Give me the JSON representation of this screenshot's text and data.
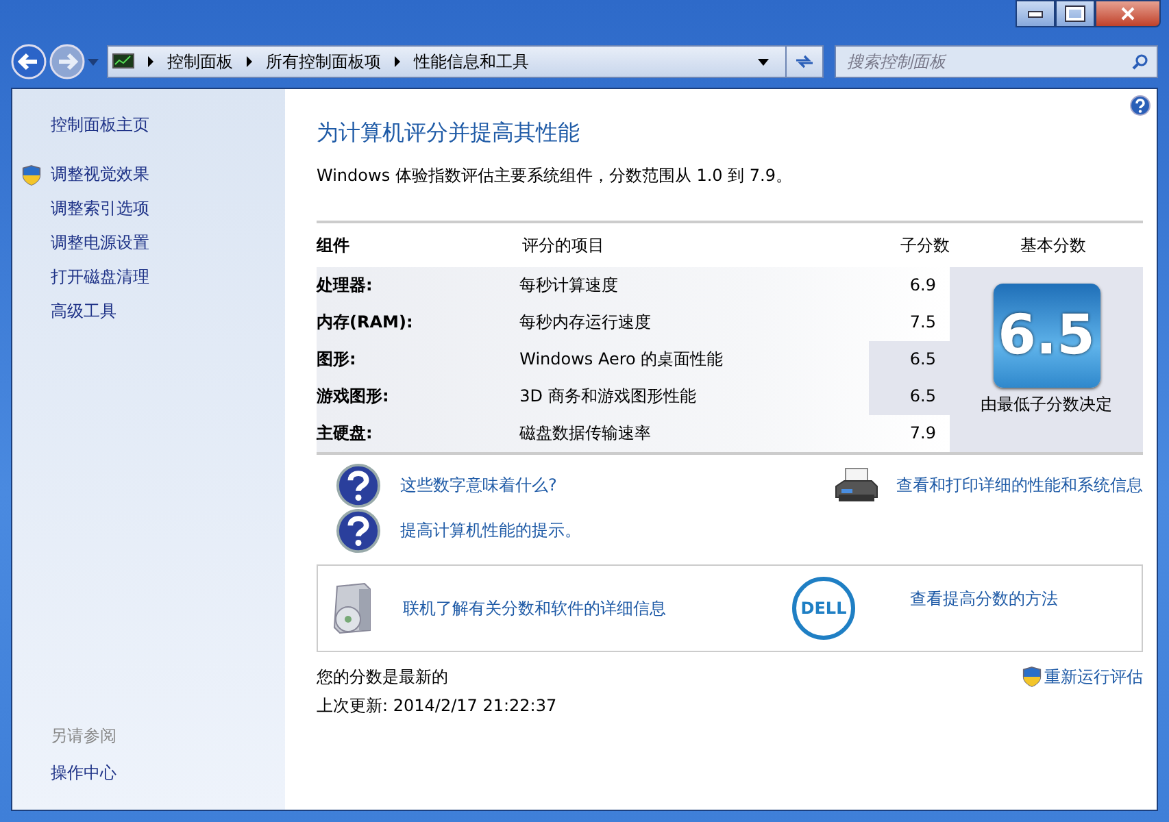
{
  "address_bar": {
    "crumbs": [
      "控制面板",
      "所有控制面板项",
      "性能信息和工具"
    ]
  },
  "search": {
    "placeholder": "搜索控制面板"
  },
  "sidebar": {
    "items": [
      {
        "label": "控制面板主页",
        "shield": false
      },
      {
        "label": "调整视觉效果",
        "shield": true
      },
      {
        "label": "调整索引选项",
        "shield": false
      },
      {
        "label": "调整电源设置",
        "shield": false
      },
      {
        "label": "打开磁盘清理",
        "shield": false
      },
      {
        "label": "高级工具",
        "shield": false
      }
    ],
    "see_also": {
      "heading": "另请参阅",
      "items": [
        "操作中心"
      ]
    }
  },
  "page": {
    "title": "为计算机评分并提高其性能",
    "description": "Windows 体验指数评估主要系统组件，分数范围从 1.0 到 7.9。"
  },
  "table": {
    "columns": [
      "组件",
      "评分的项目",
      "子分数",
      "基本分数"
    ],
    "rows": [
      {
        "component": "处理器:",
        "item": "每秒计算速度",
        "subscore": "6.9",
        "lowest": false
      },
      {
        "component": "内存(RAM):",
        "item": "每秒内存运行速度",
        "subscore": "7.5",
        "lowest": false
      },
      {
        "component": "图形:",
        "item": "Windows Aero 的桌面性能",
        "subscore": "6.5",
        "lowest": true
      },
      {
        "component": "游戏图形:",
        "item": "3D 商务和游戏图形性能",
        "subscore": "6.5",
        "lowest": true
      },
      {
        "component": "主硬盘:",
        "item": "磁盘数据传输速率",
        "subscore": "7.9",
        "lowest": false
      }
    ],
    "base_score": "6.5",
    "base_note": "由最低子分数决定"
  },
  "help_links": [
    "这些数字意味着什么?",
    "提高计算机性能的提示。"
  ],
  "print_link": "查看和打印详细的性能和系统信息",
  "vendor_box": {
    "online_link": "联机了解有关分数和软件的详细信息",
    "logo": "DELL",
    "improve_link": "查看提高分数的方法"
  },
  "status": {
    "current": "您的分数是最新的",
    "last_update": "上次更新: 2014/2/17 21:22:37",
    "rerun": "重新运行评估"
  }
}
